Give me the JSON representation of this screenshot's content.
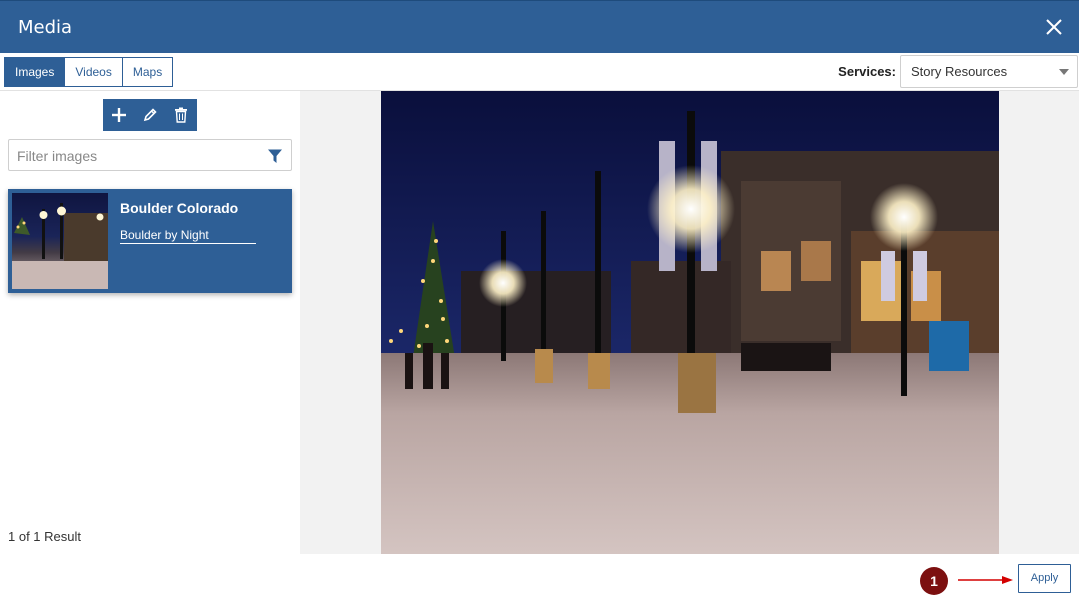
{
  "window": {
    "title": "Media"
  },
  "tabs": [
    {
      "label": "Images",
      "active": true
    },
    {
      "label": "Videos",
      "active": false
    },
    {
      "label": "Maps",
      "active": false
    }
  ],
  "services": {
    "label": "Services:",
    "selected": "Story Resources"
  },
  "filter": {
    "placeholder": "Filter images",
    "value": ""
  },
  "media_items": [
    {
      "title": "Boulder Colorado",
      "subtitle": "Boulder by Night",
      "selected": true
    }
  ],
  "result_count": "1 of 1 Result",
  "footer": {
    "step_marker": "1",
    "apply_label": "Apply"
  },
  "colors": {
    "brand": "#2e5f96",
    "marker": "#7c1010",
    "arrow": "#d40000"
  },
  "icons": [
    "close-icon",
    "plus-icon",
    "pencil-icon",
    "trash-icon",
    "filter-icon",
    "dropdown-caret-icon"
  ]
}
